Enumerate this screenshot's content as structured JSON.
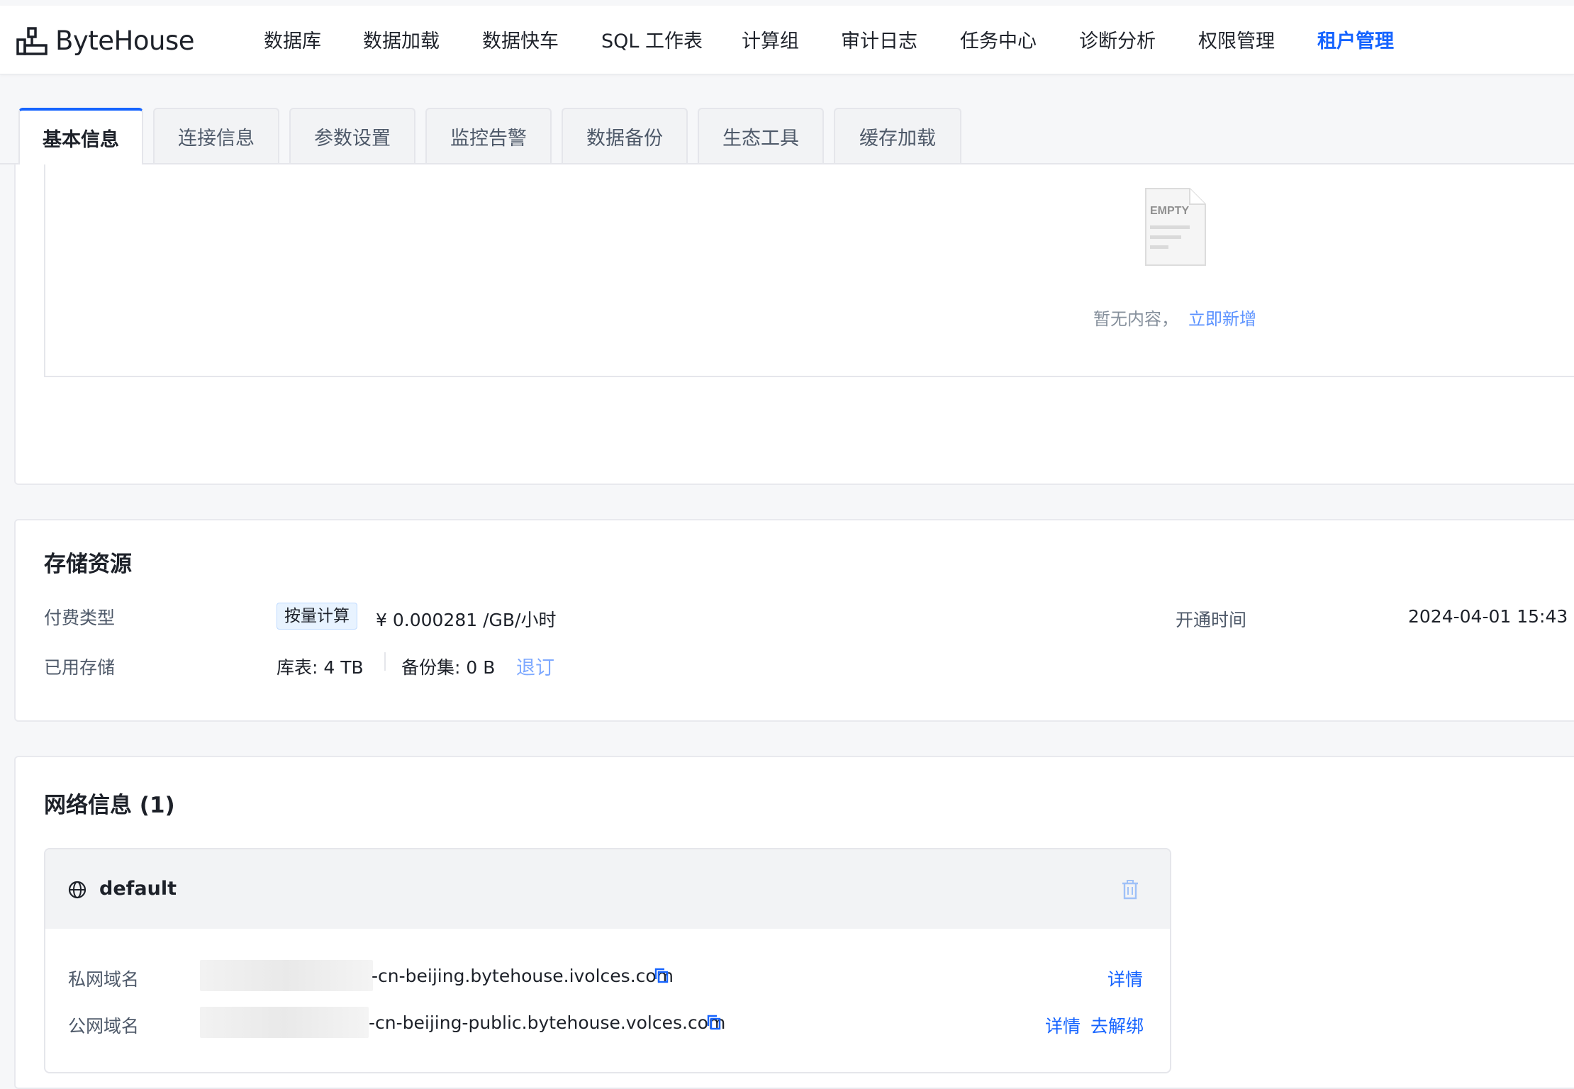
{
  "app": {
    "logo_text": "ByteHouse"
  },
  "nav": {
    "items": [
      "数据库",
      "数据加载",
      "数据快车",
      "SQL 工作表",
      "计算组",
      "审计日志",
      "任务中心",
      "诊断分析",
      "权限管理",
      "租户管理"
    ],
    "active": "租户管理"
  },
  "tabs": {
    "items": [
      "基本信息",
      "连接信息",
      "参数设置",
      "监控告警",
      "数据备份",
      "生态工具",
      "缓存加载"
    ],
    "active": "基本信息"
  },
  "empty_state": {
    "icon_text": "EMPTY",
    "text": "暂无内容，",
    "action": "立即新增"
  },
  "storage": {
    "title": "存储资源",
    "billing_label": "付费类型",
    "billing_tag": "按量计算",
    "price": "¥ 0.000281 /GB/小时",
    "open_time_label": "开通时间",
    "open_time": "2024-04-01 15:43",
    "used_label": "已用存储",
    "table_usage": "库表:  4 TB",
    "backup_usage": "备份集:  0 B",
    "unsubscribe": "退订"
  },
  "network": {
    "title": "网络信息 (1)",
    "name": "default",
    "private_label": "私网域名",
    "private_domain": "-cn-beijing.bytehouse.ivolces.com",
    "public_label": "公网域名",
    "public_domain": "-cn-beijing-public.bytehouse.volces.com",
    "detail": "详情",
    "unbind": "去解绑"
  },
  "colors": {
    "accent": "#1664ff",
    "tag_bg": "#e8f3ff",
    "header_bg": "#f2f3f5"
  }
}
